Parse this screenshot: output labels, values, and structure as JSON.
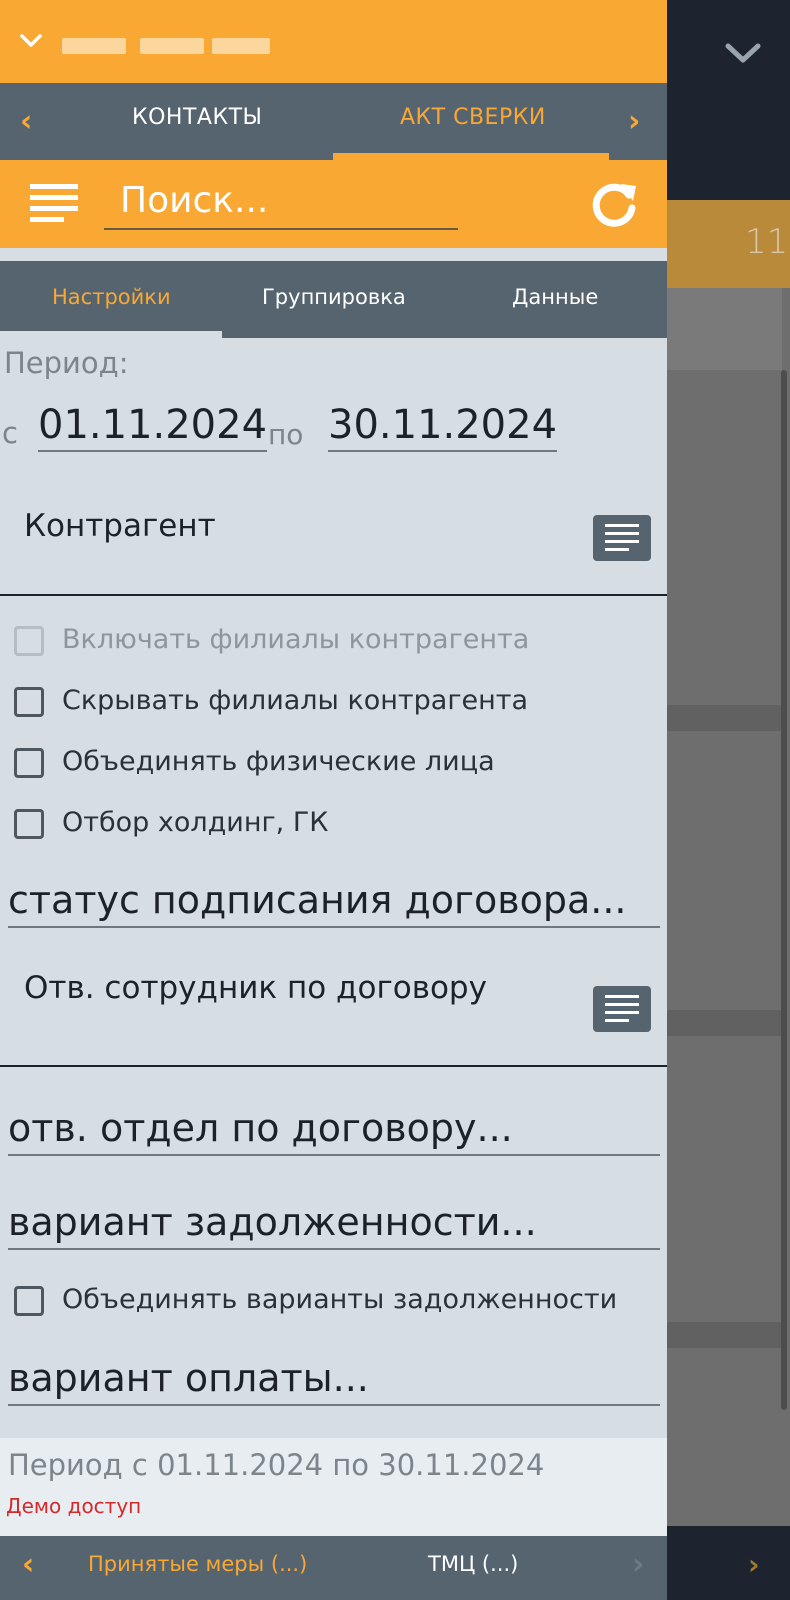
{
  "background": {
    "count_badge": "11"
  },
  "header": {
    "title_masked": true
  },
  "nav_tabs": {
    "items": [
      {
        "label": "КОНТАКТЫ",
        "active": false
      },
      {
        "label": "АКТ СВЕРКИ",
        "active": true
      }
    ]
  },
  "search": {
    "placeholder": "Поиск..."
  },
  "sub_tabs": {
    "items": [
      {
        "label": "Настройки",
        "active": true
      },
      {
        "label": "Группировка",
        "active": false
      },
      {
        "label": "Данные",
        "active": false
      }
    ]
  },
  "settings": {
    "period_label": "Период:",
    "from_label": "с",
    "date_from": "01.11.2024",
    "to_label": "по",
    "date_to": "30.11.2024",
    "counterparty_label": "Контрагент",
    "checkboxes_group1": [
      {
        "label": "Включать филиалы контрагента",
        "checked": false,
        "disabled": true
      },
      {
        "label": "Скрывать филиалы контрагента",
        "checked": false,
        "disabled": false
      },
      {
        "label": "Объединять физические лица",
        "checked": false,
        "disabled": false
      },
      {
        "label": "Отбор холдинг, ГК",
        "checked": false,
        "disabled": false
      }
    ],
    "contract_status_field": "статус подписания договора...",
    "responsible_employee_label": "Отв. сотрудник по договору",
    "responsible_department_field": "отв. отдел по договору...",
    "debt_variant_field": "вариант задолженности...",
    "merge_debt_variants": {
      "label": "Объединять варианты задолженности",
      "checked": false
    },
    "payment_variant_field": "вариант оплаты..."
  },
  "footer": {
    "period_summary": "Период с 01.11.2024 по 30.11.2024",
    "demo_note": "Демо доступ"
  },
  "bottom_nav": {
    "items": [
      {
        "label": "Принятые меры (...)"
      },
      {
        "label": "ТМЦ (...)"
      }
    ]
  },
  "colors": {
    "accent": "#f8a833",
    "bar": "#566470",
    "panel_bg": "#d6dde3",
    "error": "#d42a2a"
  }
}
